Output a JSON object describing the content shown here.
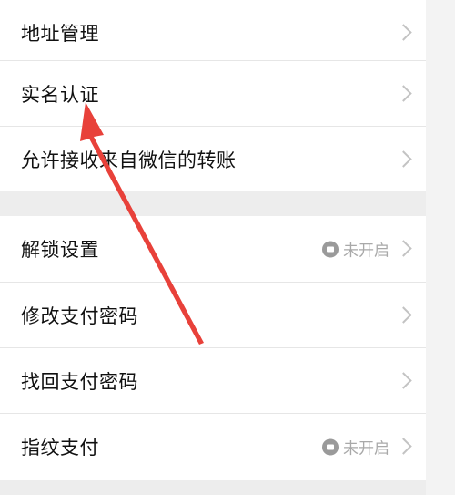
{
  "settings": {
    "group1": [
      {
        "label": "地址管理"
      },
      {
        "label": "实名认证"
      },
      {
        "label": "允许接收来自微信的转账"
      }
    ],
    "group2": [
      {
        "label": "解锁设置",
        "status": "未开启"
      },
      {
        "label": "修改支付密码"
      },
      {
        "label": "找回支付密码"
      },
      {
        "label": "指纹支付",
        "status": "未开启"
      }
    ]
  },
  "icons": {
    "chevron": "chevron-right-icon",
    "lock": "lock-icon"
  },
  "colors": {
    "background": "#ededed",
    "row": "#ffffff",
    "text": "#111111",
    "status_text": "#a9a9a9",
    "annotation_arrow": "#e8413a"
  }
}
